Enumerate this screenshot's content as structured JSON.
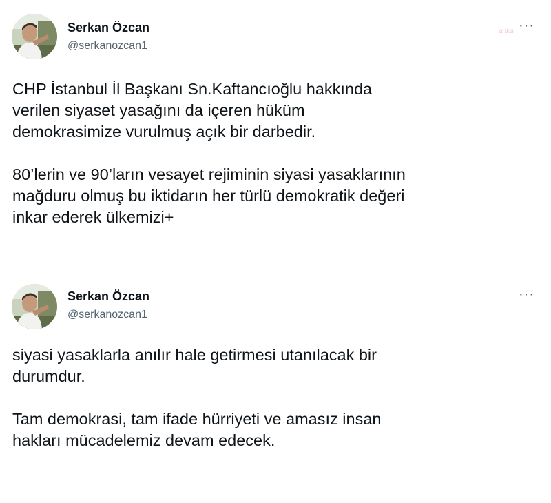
{
  "watermark": "anka",
  "tweets": [
    {
      "author_name": "Serkan Özcan",
      "author_handle": "@serkanozcan1",
      "more_label": "···",
      "paragraphs": [
        [
          "CHP İstanbul İl Başkanı Sn.Kaftancıoğlu hakkında",
          "verilen siyaset yasağını da içeren hüküm",
          "demokrasimize vurulmuş açık bir darbedir."
        ],
        [
          "80’lerin ve 90’ların vesayet rejiminin siyasi yasaklarının",
          "mağduru olmuş bu iktidarın her türlü demokratik değeri",
          "inkar ederek ülkemizi+"
        ]
      ]
    },
    {
      "author_name": "Serkan Özcan",
      "author_handle": "@serkanozcan1",
      "more_label": "···",
      "paragraphs": [
        [
          "siyasi yasaklarla anılır hale getirmesi utanılacak bir",
          "durumdur."
        ],
        [
          "Tam demokrasi, tam ifade hürriyeti ve amasız insan",
          "hakları mücadelemiz devam edecek."
        ]
      ]
    }
  ]
}
